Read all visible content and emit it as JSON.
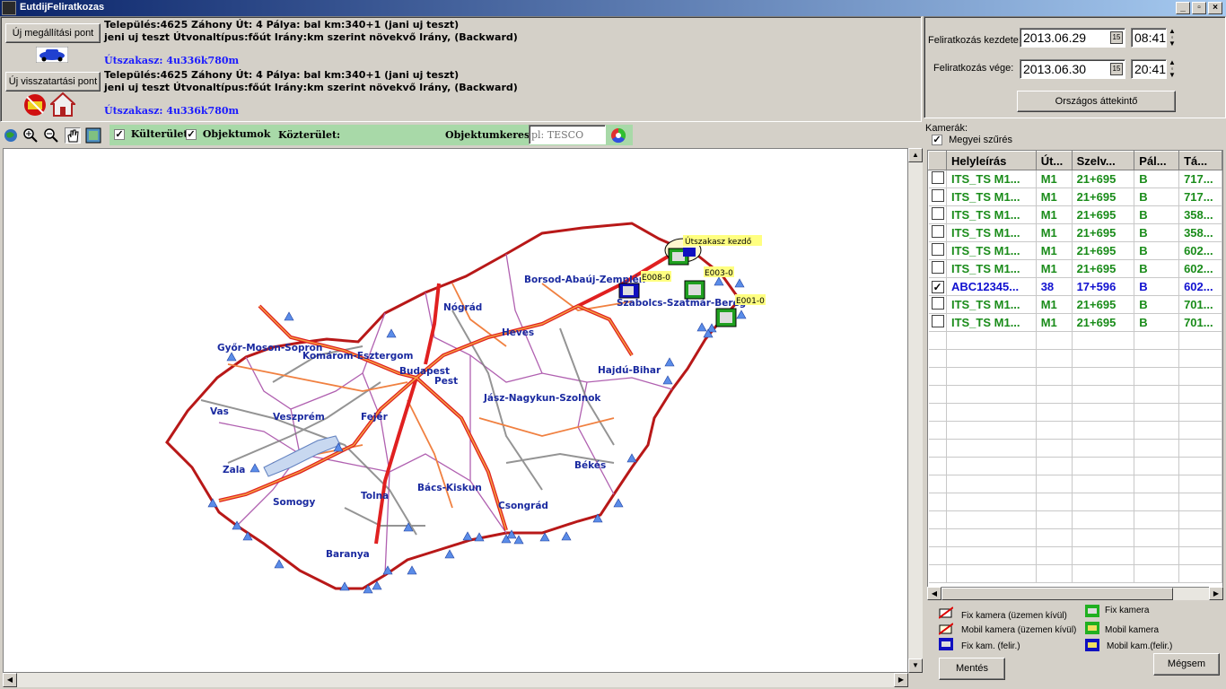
{
  "window": {
    "title": "EutdijFeliratkozas"
  },
  "stop_point": {
    "button_label": "Új megállítási pont",
    "line1": "Település:4625 Záhony Út: 4 Pálya: bal km:340+1 (jani uj teszt)",
    "line2": "jeni uj teszt Útvonaltípus:főút Irány:km szerint növekvő Irány,  (Backward)",
    "section": "Útszakasz: 4u336k780m"
  },
  "hold_point": {
    "button_label": "Új visszatartási pont",
    "line1": "Település:4625 Záhony Út: 4 Pálya: bal km:340+1 (jani uj teszt)",
    "line2": "jeni uj teszt Útvonaltípus:főút Irány:km szerint növekvő Irány,  (Backward)",
    "section": "Útszakasz: 4u336k780m"
  },
  "subscription": {
    "start_label": "Feliratkozás kezdete:",
    "start_date": "2013.06.29",
    "start_time": "08:41",
    "end_label": "Feliratkozás vége:",
    "end_date": "2013.06.30",
    "end_time": "20:41",
    "overview_button": "Országos áttekintő"
  },
  "toolbar": {
    "outdoor_label": "Külterület",
    "objects_label": "Objektumok",
    "public_area_label": "Közterület:",
    "object_search_label": "Objektumkereső",
    "object_search_placeholder": "pl: TESCO"
  },
  "map": {
    "counties": [
      {
        "name": "Győr-Moson-Sopron"
      },
      {
        "name": "Komárom-Esztergom"
      },
      {
        "name": "Budapest"
      },
      {
        "name": "Pest"
      },
      {
        "name": "Vas"
      },
      {
        "name": "Veszprém"
      },
      {
        "name": "Fejér"
      },
      {
        "name": "Zala"
      },
      {
        "name": "Somogy"
      },
      {
        "name": "Tolna"
      },
      {
        "name": "Baranya"
      },
      {
        "name": "Bács-Kiskun"
      },
      {
        "name": "Csongrád"
      },
      {
        "name": "Békés"
      },
      {
        "name": "Jász-Nagykun-Szolnok"
      },
      {
        "name": "Hajdú-Bihar"
      },
      {
        "name": "Heves"
      },
      {
        "name": "Nógrád"
      },
      {
        "name": "Borsod-Abaúj-Zemplén"
      },
      {
        "name": "Szabolcs-Szatmár-Bereg"
      }
    ],
    "labels": {
      "section_start": "Útszakasz kezdő",
      "e008": "E008-0",
      "e003": "E003-0",
      "e001": "E001-0"
    }
  },
  "cameras": {
    "title": "Kamerák:",
    "county_filter_label": "Megyei szűrés",
    "columns": [
      "Helyleírás",
      "Út...",
      "Szelv...",
      "Pál...",
      "Tá..."
    ],
    "rows": [
      {
        "checked": false,
        "desc": "ITS_TS M1...",
        "road": "M1",
        "km": "21+695",
        "lane": "B",
        "dist": "717...",
        "color": "#1a8c1a"
      },
      {
        "checked": false,
        "desc": "ITS_TS M1...",
        "road": "M1",
        "km": "21+695",
        "lane": "B",
        "dist": "717...",
        "color": "#1a8c1a"
      },
      {
        "checked": false,
        "desc": "ITS_TS M1...",
        "road": "M1",
        "km": "21+695",
        "lane": "B",
        "dist": "358...",
        "color": "#1a8c1a"
      },
      {
        "checked": false,
        "desc": "ITS_TS M1...",
        "road": "M1",
        "km": "21+695",
        "lane": "B",
        "dist": "358...",
        "color": "#1a8c1a"
      },
      {
        "checked": false,
        "desc": "ITS_TS M1...",
        "road": "M1",
        "km": "21+695",
        "lane": "B",
        "dist": "602...",
        "color": "#1a8c1a"
      },
      {
        "checked": false,
        "desc": "ITS_TS M1...",
        "road": "M1",
        "km": "21+695",
        "lane": "B",
        "dist": "602...",
        "color": "#1a8c1a"
      },
      {
        "checked": true,
        "desc": "ABC12345...",
        "road": "38",
        "km": "17+596",
        "lane": "B",
        "dist": "602...",
        "color": "#1010d0"
      },
      {
        "checked": false,
        "desc": "ITS_TS M1...",
        "road": "M1",
        "km": "21+695",
        "lane": "B",
        "dist": "701...",
        "color": "#1a8c1a"
      },
      {
        "checked": false,
        "desc": "ITS_TS M1...",
        "road": "M1",
        "km": "21+695",
        "lane": "B",
        "dist": "701...",
        "color": "#1a8c1a"
      }
    ]
  },
  "legend": {
    "fixed_off": "Fix kamera (üzemen kívül)",
    "mobile_off": "Mobil kamera (üzemen kívül)",
    "fixed_sub": "Fix kam. (felir.)",
    "fixed": "Fix kamera",
    "mobile": "Mobil kamera",
    "mobile_sub": "Mobil kam.(felir.)"
  },
  "actions": {
    "save": "Mentés",
    "cancel": "Mégsem"
  }
}
